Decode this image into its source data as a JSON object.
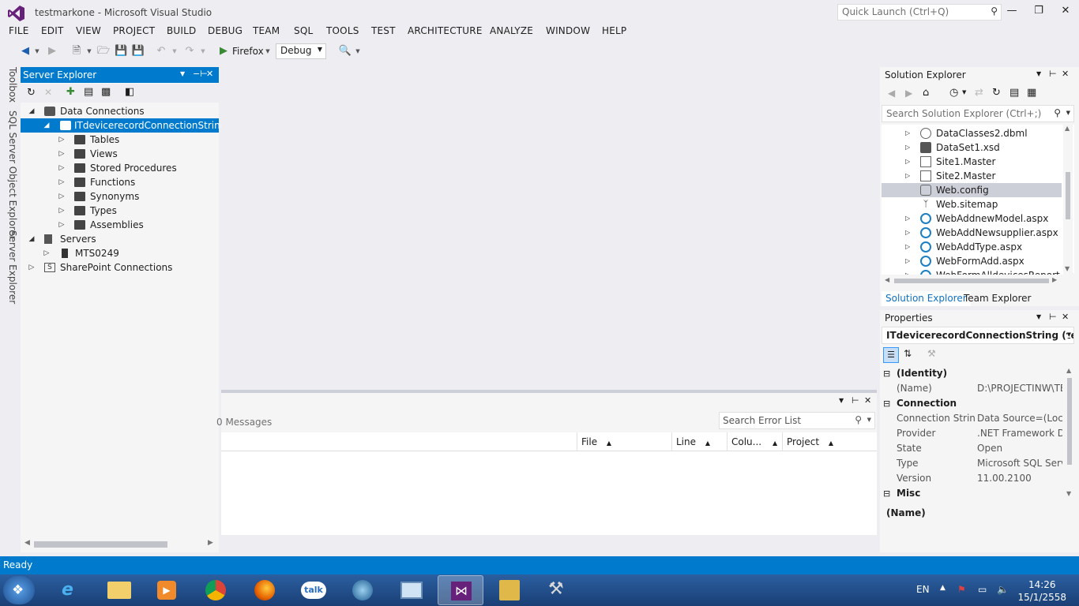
{
  "window": {
    "title": "testmarkone - Microsoft Visual Studio",
    "quick_launch_placeholder": "Quick Launch (Ctrl+Q)"
  },
  "menu": [
    "FILE",
    "EDIT",
    "VIEW",
    "PROJECT",
    "BUILD",
    "DEBUG",
    "TEAM",
    "SQL",
    "TOOLS",
    "TEST",
    "ARCHITECTURE",
    "ANALYZE",
    "WINDOW",
    "HELP"
  ],
  "toolbar": {
    "run_target": "Firefox",
    "configuration": "Debug"
  },
  "side_tabs": [
    "Toolbox",
    "SQL Server Object Explorer",
    "Server Explorer"
  ],
  "server_explorer": {
    "title": "Server Explorer",
    "tree": [
      {
        "label": "Data Connections",
        "level": 0,
        "expanded": true
      },
      {
        "label": "ITdevicerecordConnectionString (t",
        "level": 1,
        "expanded": true,
        "selected": true
      },
      {
        "label": "Tables",
        "level": 2
      },
      {
        "label": "Views",
        "level": 2
      },
      {
        "label": "Stored Procedures",
        "level": 2
      },
      {
        "label": "Functions",
        "level": 2
      },
      {
        "label": "Synonyms",
        "level": 2
      },
      {
        "label": "Types",
        "level": 2
      },
      {
        "label": "Assemblies",
        "level": 2
      },
      {
        "label": "Servers",
        "level": 0,
        "expanded": true
      },
      {
        "label": "MTS0249",
        "level": 1
      },
      {
        "label": "SharePoint Connections",
        "level": 0
      }
    ]
  },
  "error_list": {
    "messages_label": "0 Messages",
    "search_placeholder": "Search Error List",
    "columns": [
      "File",
      "Line",
      "Colu...",
      "Project"
    ]
  },
  "solution_explorer": {
    "title": "Solution Explorer",
    "search_placeholder": "Search Solution Explorer (Ctrl+;)",
    "files": [
      {
        "label": "DataClasses2.dbml",
        "expandable": true
      },
      {
        "label": "DataSet1.xsd",
        "expandable": true
      },
      {
        "label": "Site1.Master",
        "expandable": true
      },
      {
        "label": "Site2.Master",
        "expandable": true
      },
      {
        "label": "Web.config",
        "expandable": false,
        "selected": true
      },
      {
        "label": "Web.sitemap",
        "expandable": false
      },
      {
        "label": "WebAddnewModel.aspx",
        "expandable": true
      },
      {
        "label": "WebAddNewsupplier.aspx",
        "expandable": true
      },
      {
        "label": "WebAddType.aspx",
        "expandable": true
      },
      {
        "label": "WebFormAdd.aspx",
        "expandable": true
      },
      {
        "label": "WebFormAlldevicesReport.asp",
        "expandable": true
      }
    ],
    "tabs": [
      "Solution Explorer",
      "Team Explorer"
    ]
  },
  "properties": {
    "title": "Properties",
    "object": "ITdevicerecordConnectionString (testm",
    "rows": [
      {
        "category": "(Identity)"
      },
      {
        "name": "(Name)",
        "value": "D:\\PROJECTINW\\TE"
      },
      {
        "category": "Connection"
      },
      {
        "name": "Connection String",
        "value": "Data Source=(Locall"
      },
      {
        "name": "Provider",
        "value": ".NET Framework Dat"
      },
      {
        "name": "State",
        "value": "Open"
      },
      {
        "name": "Type",
        "value": "Microsoft SQL Serve"
      },
      {
        "name": "Version",
        "value": "11.00.2100"
      },
      {
        "category": "Misc"
      }
    ],
    "description_title": "(Name)"
  },
  "status_bar": {
    "text": "Ready"
  },
  "taskbar": {
    "language": "EN",
    "time": "14:26",
    "date": "15/1/2558"
  },
  "colors": {
    "accent": "#007acc",
    "background": "#eeeef2",
    "panel": "#f5f5f5"
  }
}
